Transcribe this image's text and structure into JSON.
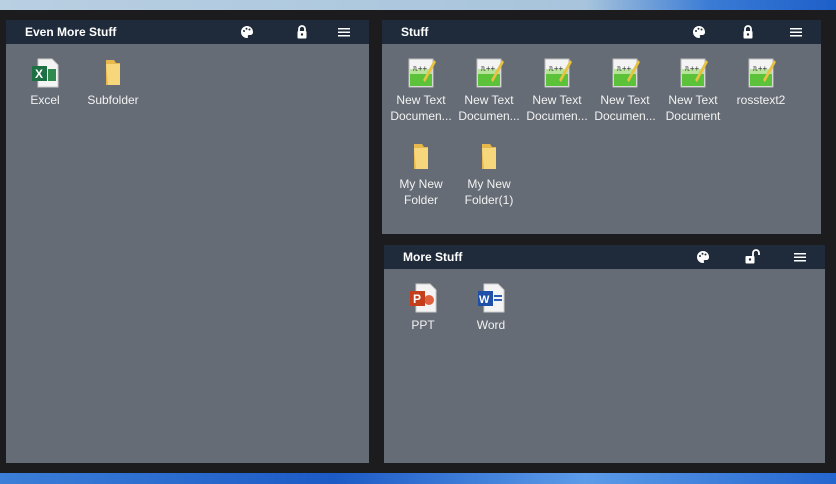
{
  "panels": [
    {
      "title": "Even More Stuff",
      "locked": true,
      "items": [
        {
          "label": "Excel",
          "icon": "excel-icon"
        },
        {
          "label": "Subfolder",
          "icon": "folder-icon"
        }
      ]
    },
    {
      "title": "Stuff",
      "locked": true,
      "items": [
        {
          "label": "New Text Documen...",
          "icon": "notepadpp-icon"
        },
        {
          "label": "New Text Documen...",
          "icon": "notepadpp-icon"
        },
        {
          "label": "New Text Documen...",
          "icon": "notepadpp-icon"
        },
        {
          "label": "New Text Documen...",
          "icon": "notepadpp-icon"
        },
        {
          "label": "New Text Document",
          "icon": "notepadpp-icon"
        },
        {
          "label": "rosstext2",
          "icon": "notepadpp-icon"
        },
        {
          "label": "My New Folder",
          "icon": "folder-icon"
        },
        {
          "label": "My New Folder(1)",
          "icon": "folder-icon"
        }
      ]
    },
    {
      "title": "More Stuff",
      "locked": false,
      "items": [
        {
          "label": "PPT",
          "icon": "powerpoint-icon"
        },
        {
          "label": "Word",
          "icon": "word-icon"
        }
      ]
    }
  ]
}
